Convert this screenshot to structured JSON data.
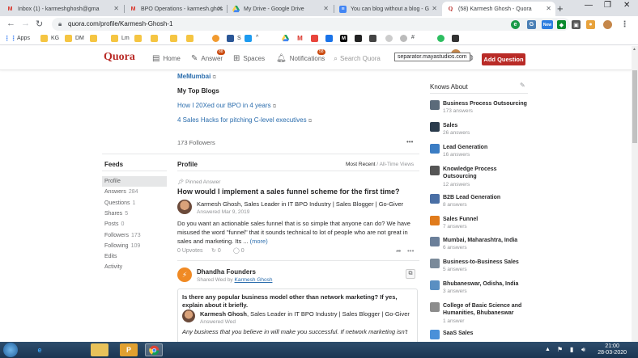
{
  "browser": {
    "tabs": [
      {
        "title": "Inbox (1) - karmeshghosh@gma",
        "icon": "gmail-icon",
        "color": "#d93025",
        "active": false
      },
      {
        "title": "BPO Operations - karmesh.ghos",
        "icon": "gmail-icon",
        "color": "#d93025",
        "active": false
      },
      {
        "title": "My Drive - Google Drive",
        "icon": "drive-icon",
        "color": "#1fa463",
        "active": false
      },
      {
        "title": "You can blog without a blog - G",
        "icon": "docs-icon",
        "color": "#4285f4",
        "active": false
      },
      {
        "title": "(58) Karmesh Ghosh - Quora",
        "icon": "quora-icon",
        "color": "#b92b27",
        "active": true
      }
    ],
    "url": "quora.com/profile/Karmesh-Ghosh-1",
    "bookmarks": [
      {
        "label": "Apps"
      },
      {
        "label": "KG"
      },
      {
        "label": "DM"
      },
      {
        "label": "Lm"
      },
      {
        "label": "S"
      },
      {
        "label": "^"
      },
      {
        "label": "#"
      }
    ],
    "ext_new": "New"
  },
  "quora": {
    "logo": "Quora",
    "nav": {
      "home": "Home",
      "answer": "Answer",
      "answer_badge": "88",
      "spaces": "Spaces",
      "notifications": "Notifications",
      "notifications_badge": "58"
    },
    "search_placeholder": "Search Quora",
    "tooltip": "separator.mayastudios.com",
    "add_question": "Add Question"
  },
  "profile": {
    "blog_top_link": "MeMumbai",
    "my_top_blogs_heading": "My Top Blogs",
    "blogs": [
      "How I 20Xed our BPO in 4 years",
      "4 Sales Hacks for pitching C-level executives"
    ],
    "followers": "173 Followers",
    "more_dots": "•••"
  },
  "feeds": {
    "heading": "Feeds",
    "items": [
      {
        "label": "Profile",
        "count": ""
      },
      {
        "label": "Answers",
        "count": "284"
      },
      {
        "label": "Questions",
        "count": "1"
      },
      {
        "label": "Shares",
        "count": "5"
      },
      {
        "label": "Posts",
        "count": "0"
      },
      {
        "label": "Followers",
        "count": "173"
      },
      {
        "label": "Following",
        "count": "109"
      },
      {
        "label": "Edits",
        "count": ""
      },
      {
        "label": "Activity",
        "count": ""
      }
    ]
  },
  "main": {
    "section_title": "Profile",
    "sort_most_recent": "Most Recent",
    "sort_sep": " / ",
    "sort_all_time": "All-Time Views",
    "pinned_label": "Pinned Answer",
    "question": "How would I implement a sales funnel scheme for the first time?",
    "author_line": "Karmesh Ghosh, Sales Leader in IT BPO Industry | Sales Blogger | Go-Giver",
    "answered": "Answered Mar 9, 2019",
    "answer_text": "Do you want an actionable sales funnel that is so simple that anyone can do? We have misused the word \"funnel\" that it sounds technical to lot of people who are not great in sales and marketing. Its ...",
    "more": "(more)",
    "upvotes": "0 Upvotes",
    "shares_count": "0",
    "comments_count": "0",
    "shared_source": "Dhandha Founders",
    "shared_by_prefix": "Shared Wed by ",
    "shared_by_name": "Karmesh Ghosh",
    "shared_question": "Is there any popular business model other than network marketing? If yes, explain about it briefly.",
    "shared_author": "Karmesh Ghosh",
    "shared_author_cred": ", Sales Leader in IT BPO Industry | Sales Blogger | Go-Giver",
    "shared_answered": "Answered Wed",
    "shared_answer_text": "Any business that you believe in will make you successful. If network marketing isn't"
  },
  "knows_about": {
    "heading": "Knows About",
    "topics": [
      {
        "name": "Business Process Outsourcing",
        "answers": "173 answers",
        "color": "#5b6b7a"
      },
      {
        "name": "Sales",
        "answers": "26 answers",
        "color": "#2a3b4c"
      },
      {
        "name": "Lead Generation",
        "answers": "16 answers",
        "color": "#3b7dc4"
      },
      {
        "name": "Knowledge Process Outsourcing",
        "answers": "12 answers",
        "color": "#555555"
      },
      {
        "name": "B2B Lead Generation",
        "answers": "8 answers",
        "color": "#4a6fa5"
      },
      {
        "name": "Sales Funnel",
        "answers": "7 answers",
        "color": "#e07b1c"
      },
      {
        "name": "Mumbai, Maharashtra, India",
        "answers": "6 answers",
        "color": "#6b7f99"
      },
      {
        "name": "Business-to-Business Sales",
        "answers": "5 answers",
        "color": "#7a8a9a"
      },
      {
        "name": "Bhubaneswar, Odisha, India",
        "answers": "3 answers",
        "color": "#5a8fc2"
      },
      {
        "name": "College of Basic Science and Humanities, Bhubaneswar",
        "answers": "1 answer",
        "color": "#8c8c8c"
      },
      {
        "name": "SaaS Sales",
        "answers": "",
        "color": "#4a90d9"
      }
    ]
  },
  "taskbar": {
    "time": "21:00",
    "date": "28-03-2020"
  }
}
